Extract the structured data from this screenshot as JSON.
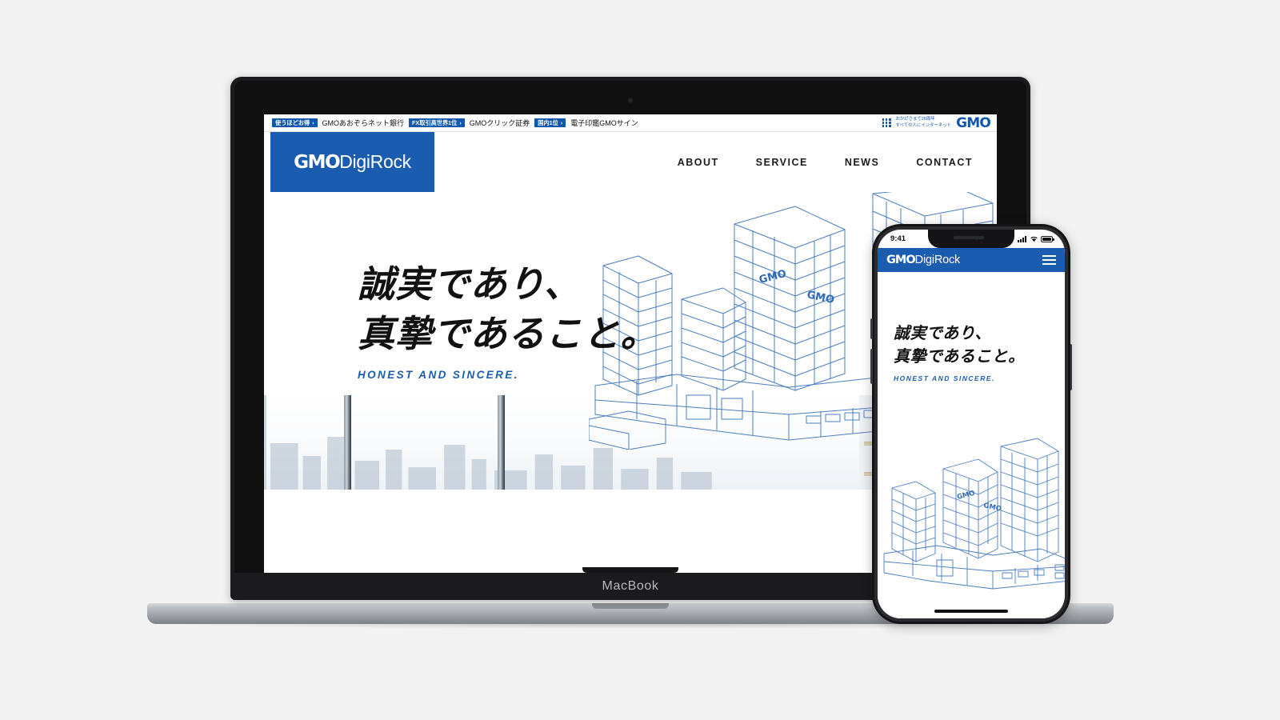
{
  "device": {
    "laptop_label": "MacBook",
    "phone_status": {
      "time": "9:41",
      "signal_icon": "cellular-signal-icon",
      "wifi_icon": "wifi-icon",
      "battery_icon": "battery-icon"
    }
  },
  "colors": {
    "brand_blue": "#1a5cb0",
    "utilbar_blue": "#1157ad",
    "page_background": "#f2f2f2",
    "text_dark": "#111111"
  },
  "utilbar": {
    "items": [
      {
        "badge": "使うほどお得",
        "arrow": "›",
        "name": "GMOあおぞらネット銀行"
      },
      {
        "badge": "FX取引高世界1位",
        "arrow": "›",
        "name": "GMOクリック証券"
      },
      {
        "badge": "国内1位",
        "arrow": "›",
        "name": "電子印鑑GMOサイン"
      }
    ],
    "corp": {
      "tagline_line1": "おかげさまで26周年",
      "tagline_line2": "すべての人にインターネット",
      "mark": "GMO",
      "dots_icon": "grid-dots-icon"
    }
  },
  "header": {
    "logo_bold": "GMO",
    "logo_light": "DigiRock",
    "nav": [
      {
        "label": "ABOUT"
      },
      {
        "label": "SERVICE"
      },
      {
        "label": "NEWS"
      },
      {
        "label": "CONTACT"
      }
    ]
  },
  "hero": {
    "headline_line1": "誠実であり、",
    "headline_line2": "真摯であること。",
    "subtitle": "HONEST AND SINCERE.",
    "illustration_name": "gmo-building-wireframe-illustration",
    "building_sign_1": "GMO",
    "building_sign_2": "GMO"
  },
  "mobile": {
    "logo_bold": "GMO",
    "logo_light": "DigiRock",
    "menu_icon": "hamburger-menu-icon",
    "headline_line1": "誠実であり、",
    "headline_line2": "真摯であること。",
    "subtitle": "HONEST AND SINCERE."
  }
}
